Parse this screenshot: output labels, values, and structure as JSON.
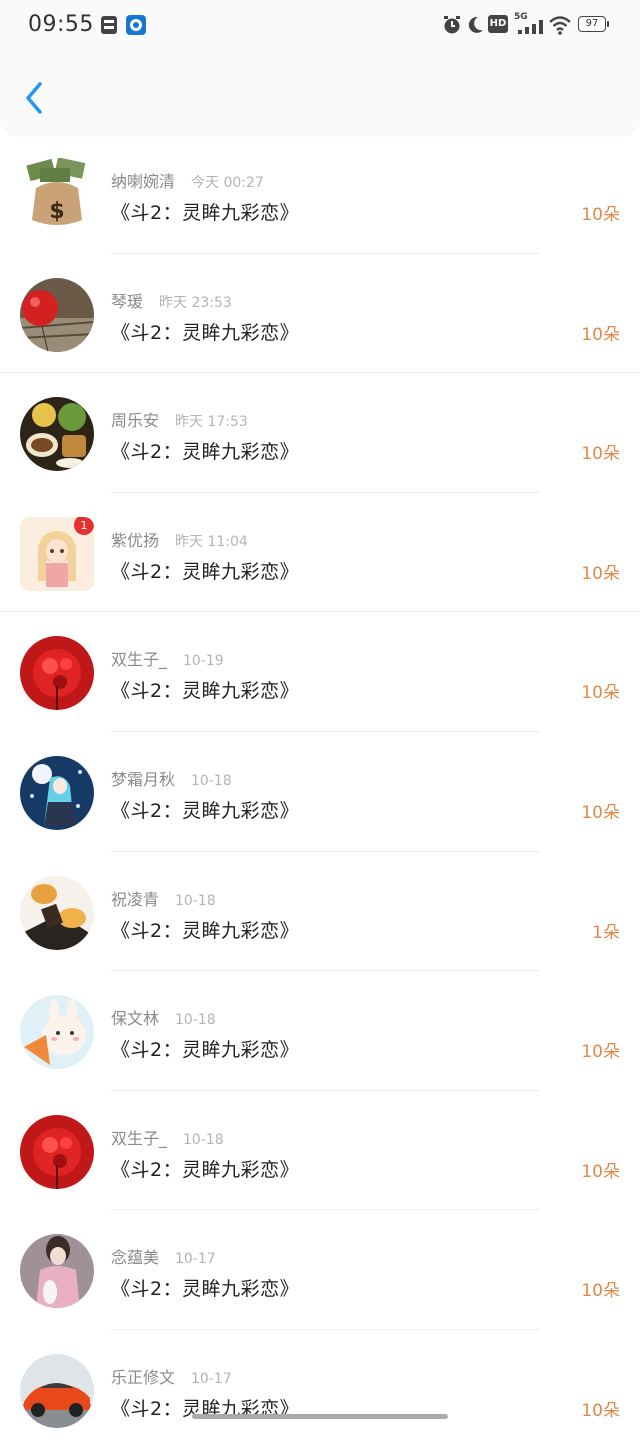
{
  "status_bar": {
    "time": "09:55",
    "icons": [
      "sim-card-icon",
      "app-notification-icon",
      "alarm-icon",
      "moon-icon",
      "hd-icon",
      "signal-5g-icon",
      "wifi-icon",
      "battery-icon"
    ],
    "network": "5G",
    "hd": "HD",
    "battery": "97"
  },
  "header": {
    "back_icon": "chevron-left-icon",
    "accent": "#2196f3"
  },
  "colors": {
    "amount": "#e0894a",
    "name": "#8a8a8a",
    "time": "#b4b4b4"
  },
  "gifts": [
    {
      "name": "纳喇婉清",
      "time": "今天 00:27",
      "title": "《斗2：灵眸九彩恋》",
      "amount": "10朵"
    },
    {
      "name": "琴瑗",
      "time": "昨天 23:53",
      "title": "《斗2：灵眸九彩恋》",
      "amount": "10朵"
    },
    {
      "name": "周乐安",
      "time": "昨天 17:53",
      "title": "《斗2：灵眸九彩恋》",
      "amount": "10朵"
    },
    {
      "name": "紫优扬",
      "time": "昨天 11:04",
      "title": "《斗2：灵眸九彩恋》",
      "amount": "10朵"
    },
    {
      "name": "双生子_",
      "time": "10-19",
      "title": "《斗2：灵眸九彩恋》",
      "amount": "10朵"
    },
    {
      "name": "梦霜月秋",
      "time": "10-18",
      "title": "《斗2：灵眸九彩恋》",
      "amount": "10朵"
    },
    {
      "name": "祝凌青",
      "time": "10-18",
      "title": "《斗2：灵眸九彩恋》",
      "amount": "1朵"
    },
    {
      "name": "保文林",
      "time": "10-18",
      "title": "《斗2：灵眸九彩恋》",
      "amount": "10朵"
    },
    {
      "name": "双生子_",
      "time": "10-18",
      "title": "《斗2：灵眸九彩恋》",
      "amount": "10朵"
    },
    {
      "name": "念蕴美",
      "time": "10-17",
      "title": "《斗2：灵眸九彩恋》",
      "amount": "10朵"
    },
    {
      "name": "乐正修文",
      "time": "10-17",
      "title": "《斗2：灵眸九彩恋》",
      "amount": "10朵"
    }
  ]
}
